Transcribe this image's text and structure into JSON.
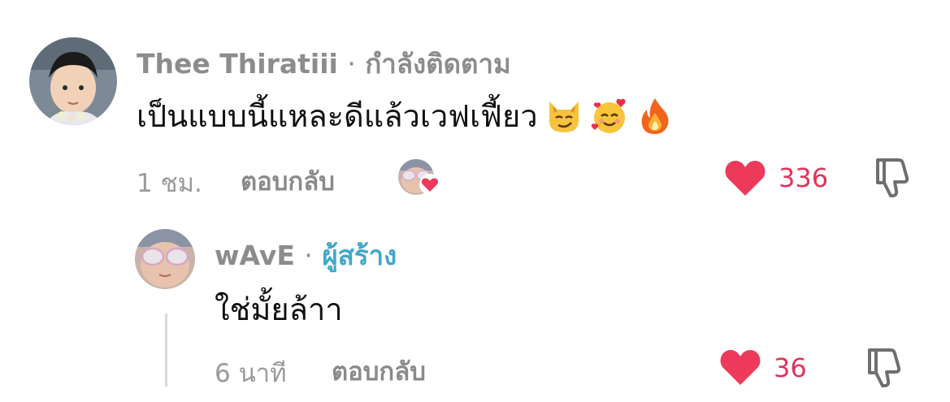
{
  "comment": {
    "author": "Thee Thiratiii",
    "separator": "·",
    "status": "กำลังติดตาม",
    "text": "เป็นแบบนี้แหละดีแล้วเวฟเฟี้ยว",
    "emojis": [
      "smirking-cat-emoji",
      "smiling-face-with-hearts-emoji",
      "fire-emoji"
    ],
    "time": "1 ชม.",
    "reply_label": "ตอบกลับ",
    "likes": "336",
    "creator_liked": true
  },
  "reply": {
    "author": "wAvE",
    "separator": "·",
    "badge": "ผู้สร้าง",
    "text": "ใช่มั้ยล้าา",
    "time": "6 นาที",
    "reply_label": "ตอบกลับ",
    "likes": "36"
  },
  "colors": {
    "heart": "#ee3a5a",
    "creator_badge": "#3fa8c9",
    "muted_text": "#8c8c8c"
  }
}
